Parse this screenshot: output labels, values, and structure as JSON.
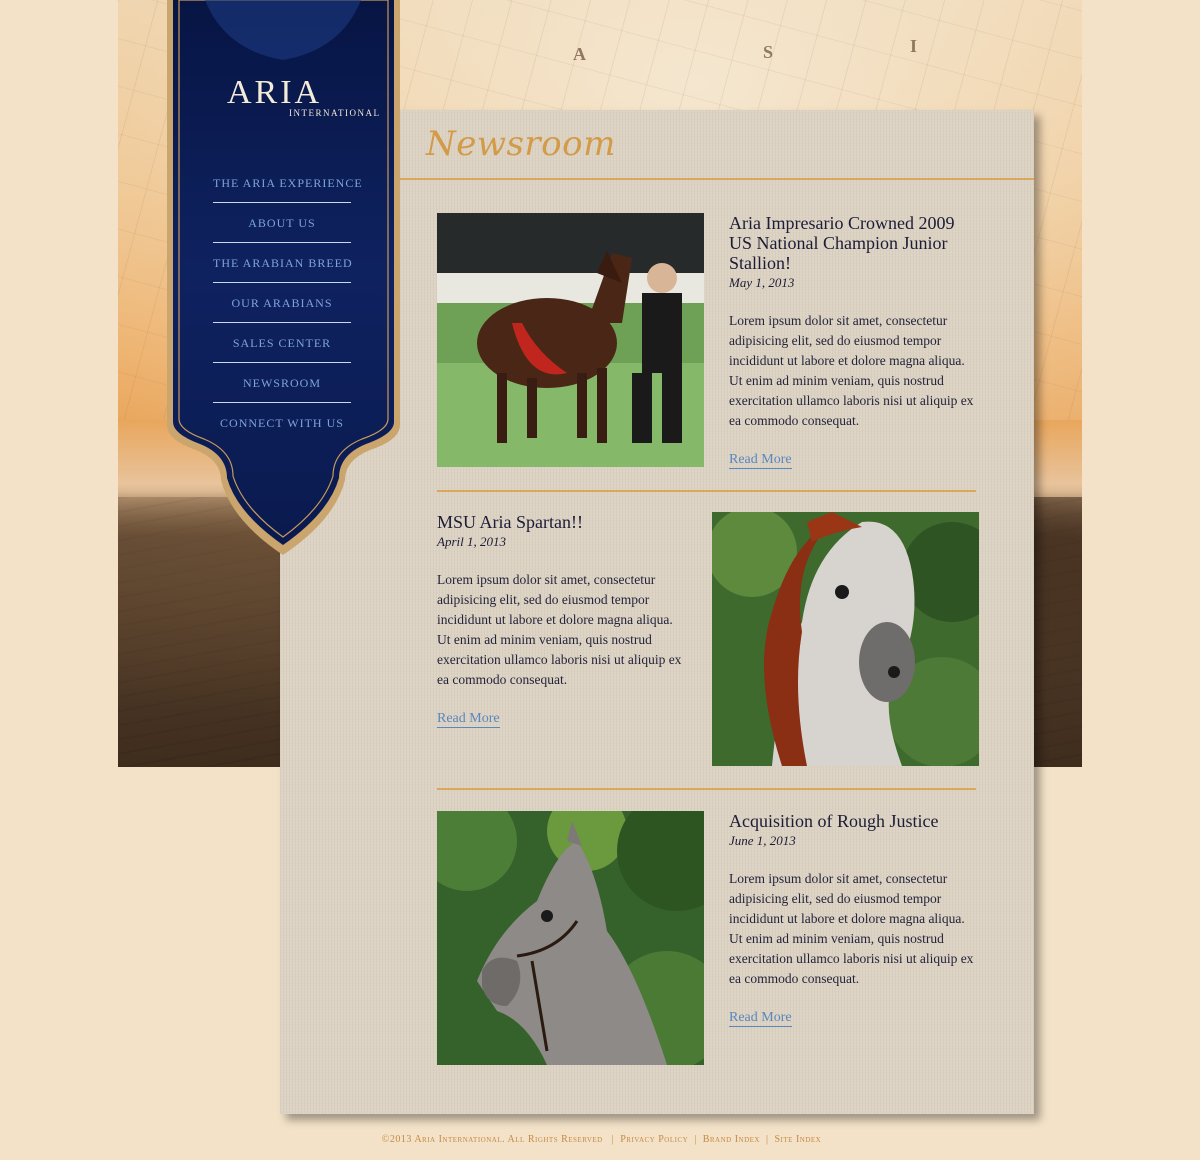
{
  "site": {
    "logo_main": "ARIA",
    "logo_sub": "INTERNATIONAL"
  },
  "nav": {
    "items": [
      "THE ARIA EXPERIENCE",
      "ABOUT US",
      "THE ARABIAN BREED",
      "OUR ARABIANS",
      "SALES CENTER",
      "NEWSROOM",
      "CONNECT WITH US"
    ]
  },
  "page": {
    "title": "Newsroom"
  },
  "articles": [
    {
      "headline": "Aria Impresario Crowned 2009 US National Champion Junior Stallion!",
      "date": "May 1, 2013",
      "body": "Lorem ipsum dolor sit amet, consectetur adipisicing elit, sed do eiusmod tempor incididunt ut labore et dolore magna aliqua. Ut enim ad minim veniam, quis nostrud exercitation ullamco laboris nisi ut aliquip ex ea commodo consequat.",
      "read_more": "Read More"
    },
    {
      "headline": "MSU Aria Spartan!!",
      "date": "April 1, 2013",
      "body": "Lorem ipsum dolor sit amet, consectetur adipisicing elit, sed do eiusmod tempor incididunt ut labore et dolore magna aliqua. Ut enim ad minim veniam, quis nostrud exercitation ullamco laboris nisi ut aliquip ex ea commodo consequat.",
      "read_more": "Read More"
    },
    {
      "headline": "Acquisition of Rough Justice",
      "date": "June 1, 2013",
      "body": "Lorem ipsum dolor sit amet, consectetur adipisicing elit, sed do eiusmod tempor incididunt ut labore et dolore magna aliqua. Ut enim ad minim veniam, quis nostrud exercitation ullamco laboris nisi ut aliquip ex ea commodo consequat.",
      "read_more": "Read More"
    }
  ],
  "footer": {
    "copyright": "©2013 Aria International. All Rights Reserved",
    "links": [
      "Privacy Policy",
      "Brand Index",
      "Site Index"
    ],
    "separator": "|"
  },
  "map_labels": [
    "A",
    "S",
    "I"
  ],
  "colors": {
    "background": "#f3e2c8",
    "panel": "#dcd3c3",
    "accent_gold": "#d9a85c",
    "title_gold": "#d39a47",
    "nav_navy": "#0c1a4e",
    "nav_text": "#7ea4da",
    "link_blue": "#5b86c0",
    "footer_text": "#c38a45"
  }
}
